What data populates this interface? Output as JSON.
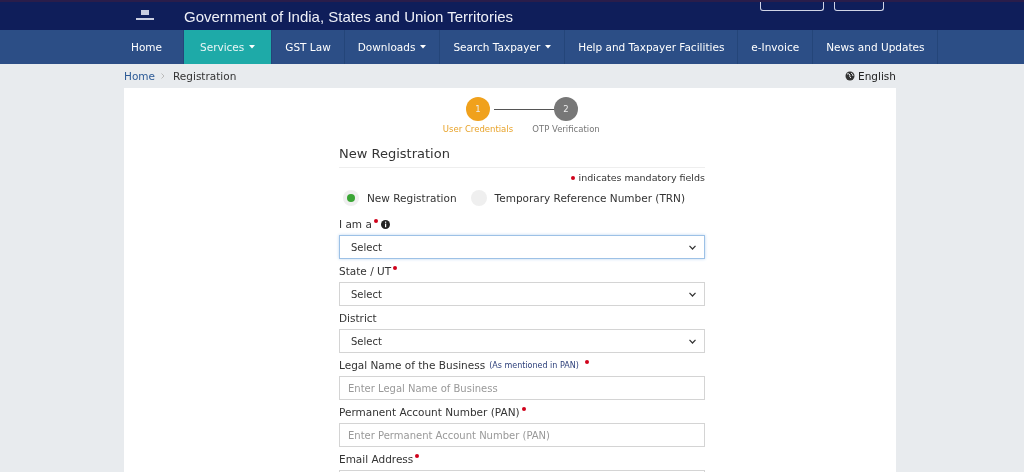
{
  "header": {
    "title": "Government of India, States and Union Territories"
  },
  "nav": [
    {
      "label": "Home",
      "selected": false,
      "dropdown": false
    },
    {
      "label": "Services",
      "selected": true,
      "dropdown": true
    },
    {
      "label": "GST Law",
      "selected": false,
      "dropdown": false
    },
    {
      "label": "Downloads",
      "selected": false,
      "dropdown": true
    },
    {
      "label": "Search Taxpayer",
      "selected": false,
      "dropdown": true
    },
    {
      "label": "Help and Taxpayer Facilities",
      "selected": false,
      "dropdown": false
    },
    {
      "label": "e-Invoice",
      "selected": false,
      "dropdown": false
    },
    {
      "label": "News and Updates",
      "selected": false,
      "dropdown": false
    }
  ],
  "breadcrumb": [
    {
      "label": "Home",
      "link": true
    },
    {
      "label": "Registration",
      "link": false
    }
  ],
  "language": "English",
  "steps": [
    {
      "number": "1",
      "label": "User Credentials",
      "active": true
    },
    {
      "number": "2",
      "label": "OTP Verification",
      "active": false
    }
  ],
  "form": {
    "title": "New Registration",
    "mandatory_note": "indicates mandatory fields",
    "radios": [
      {
        "label": "New Registration",
        "selected": true
      },
      {
        "label": "Temporary Reference Number (TRN)",
        "selected": false
      }
    ],
    "fields": [
      {
        "kind": "select",
        "label": "I am a",
        "required": true,
        "info": true,
        "value": "Select",
        "focused": true
      },
      {
        "kind": "select",
        "label": "State / UT",
        "required": true,
        "info": false,
        "value": "Select",
        "focused": false
      },
      {
        "kind": "select",
        "label": "District",
        "required": false,
        "info": false,
        "value": "Select",
        "focused": false
      },
      {
        "kind": "text",
        "label": "Legal Name of the Business",
        "note": "(As mentioned in PAN)",
        "required": true,
        "info": false,
        "placeholder": "Enter Legal Name of Business",
        "focused": false
      },
      {
        "kind": "text",
        "label": "Permanent Account Number (PAN)",
        "required": true,
        "info": false,
        "placeholder": "Enter Permanent Account Number (PAN)",
        "focused": false
      },
      {
        "kind": "text",
        "label": "Email Address",
        "required": true,
        "info": false,
        "focused": false
      }
    ]
  }
}
